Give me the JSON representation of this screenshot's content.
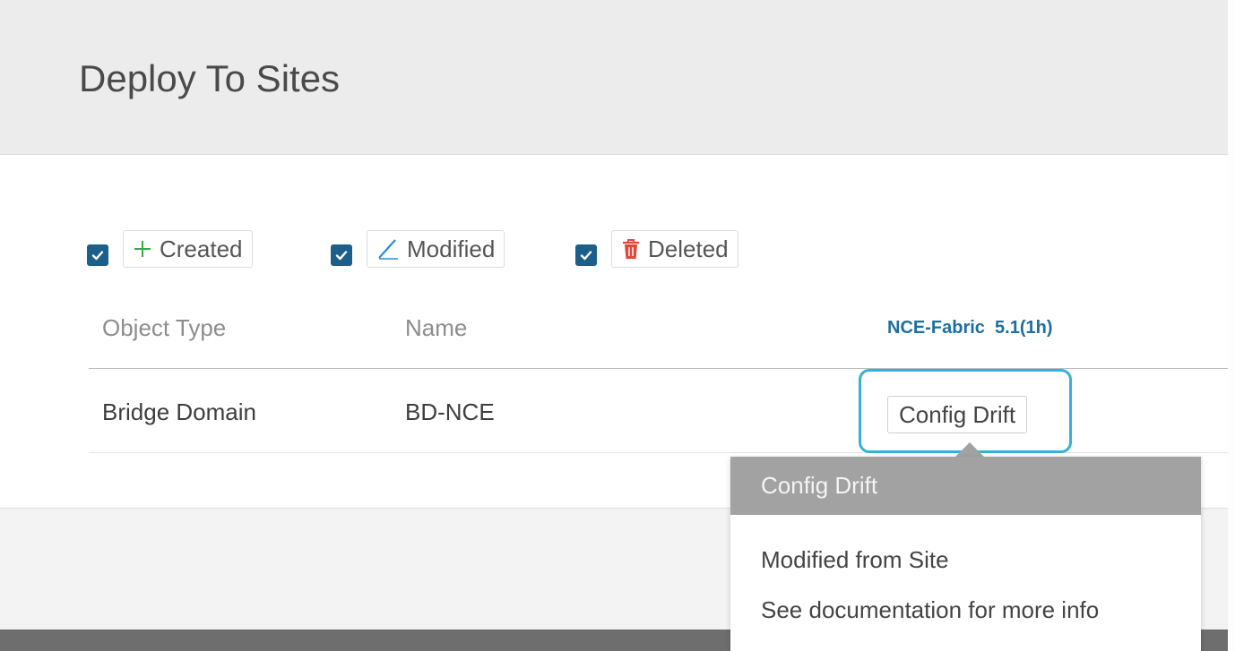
{
  "header": {
    "title": "Deploy To Sites"
  },
  "filters": [
    {
      "label": "Created",
      "checked": true,
      "icon": "plus-icon",
      "icon_color": "#39a845"
    },
    {
      "label": "Modified",
      "checked": true,
      "icon": "pencil-icon",
      "icon_color": "#2a8fd0"
    },
    {
      "label": "Deleted",
      "checked": true,
      "icon": "trash-icon",
      "icon_color": "#e0463a"
    }
  ],
  "table": {
    "columns": [
      "Object Type",
      "Name"
    ],
    "site_column": "NCE-Fabric  5.1(1h)",
    "rows": [
      {
        "object_type": "Bridge Domain",
        "name": "BD-NCE",
        "status": "Config Drift"
      }
    ]
  },
  "popover": {
    "title": "Config Drift",
    "lines": [
      "Modified from Site",
      "See documentation for more info"
    ]
  },
  "colors": {
    "checkbox": "#1b5f8a",
    "site_header": "#1d6f9e",
    "focus_ring": "#34b1d5"
  }
}
